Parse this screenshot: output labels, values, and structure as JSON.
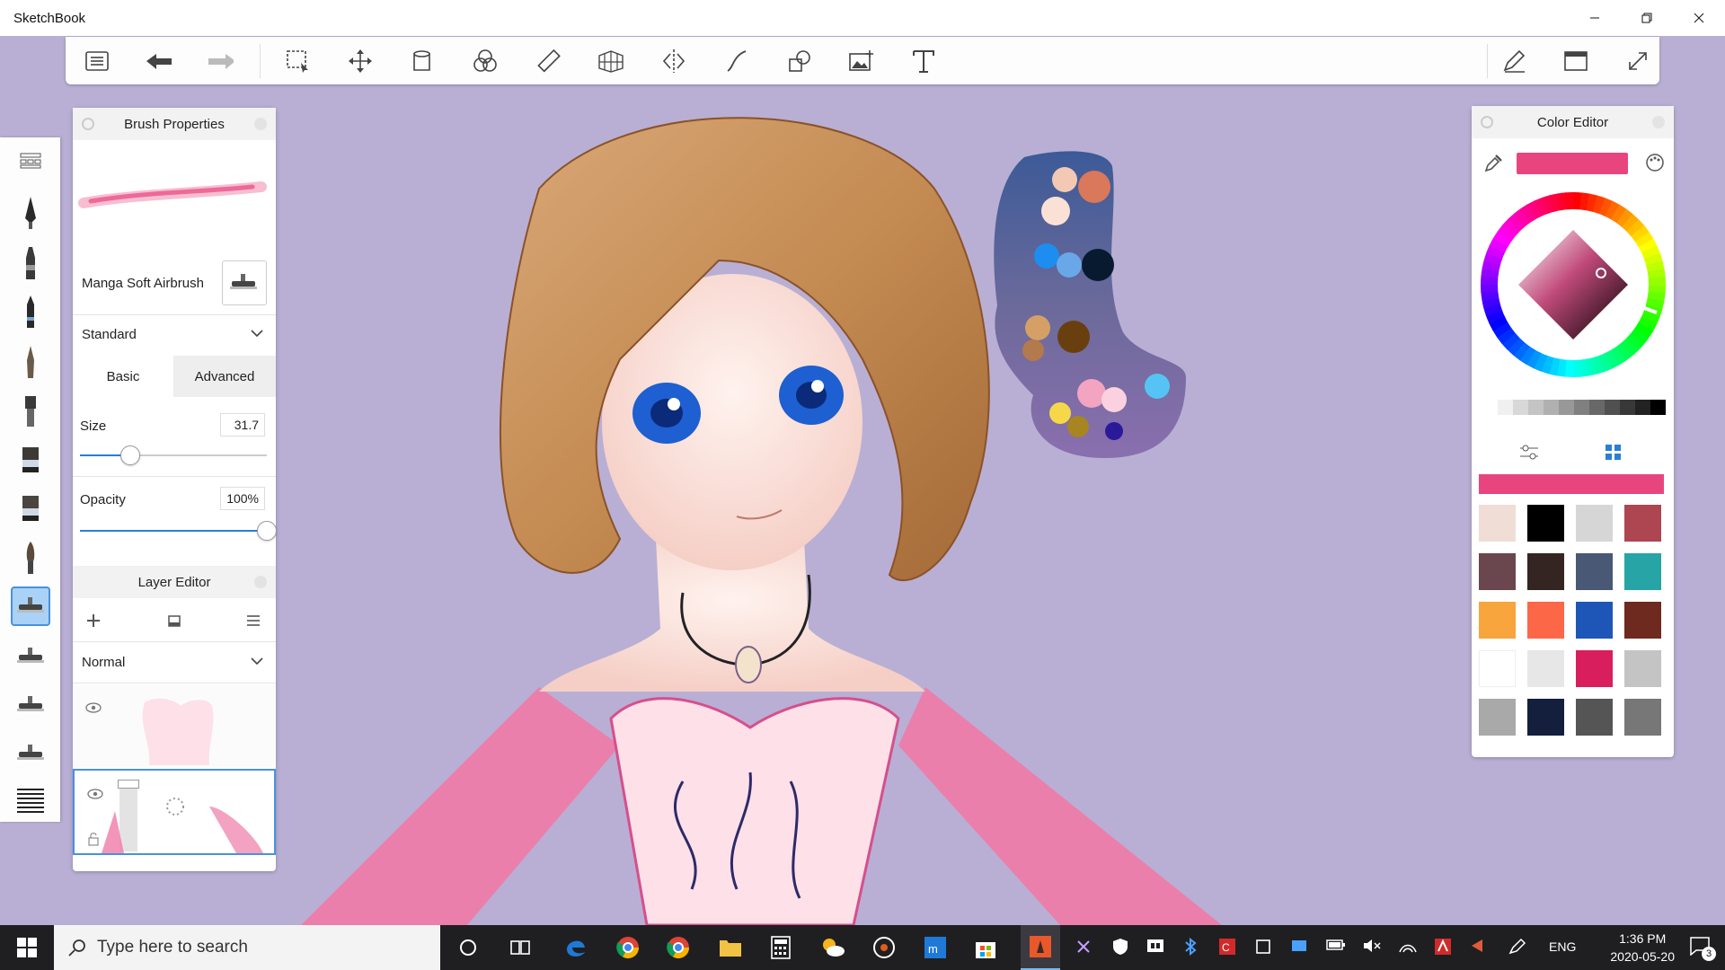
{
  "window": {
    "title": "SketchBook"
  },
  "brush_properties": {
    "title": "Brush Properties",
    "brush_name": "Manga Soft Airbrush",
    "preset": "Standard",
    "tabs": [
      "Basic",
      "Advanced"
    ],
    "size_label": "Size",
    "size_value": "31.7",
    "size_level": 0.27,
    "opacity_label": "Opacity",
    "opacity_value": "100%",
    "opacity_level": 1.0
  },
  "layer_editor": {
    "title": "Layer Editor",
    "blend_mode": "Normal"
  },
  "color_editor": {
    "title": "Color Editor",
    "current_color": "#e8457f",
    "grays": [
      "#ffffff",
      "#f0f0f0",
      "#d8d8d8",
      "#c4c4c4",
      "#b0b0b0",
      "#989898",
      "#808080",
      "#686868",
      "#505050",
      "#383838",
      "#222222",
      "#000000"
    ],
    "swatches": [
      "#f0ddd5",
      "#000000",
      "#d6d6d6",
      "#ad4650",
      "#6a464e",
      "#352522",
      "#485875",
      "#27a4a6",
      "#f7a53c",
      "#fb6747",
      "#1e56b8",
      "#6e2a1e",
      "#ffffff",
      "#e7e7e7",
      "#d91e5d",
      "#c4c4c4",
      "#a9a9a9",
      "#141f3e",
      "#555555",
      "#777777"
    ]
  },
  "taskbar": {
    "search_placeholder": "Type here to search",
    "language": "ENG",
    "time": "1:36 PM",
    "date": "2020-05-20",
    "notification_count": "3"
  }
}
